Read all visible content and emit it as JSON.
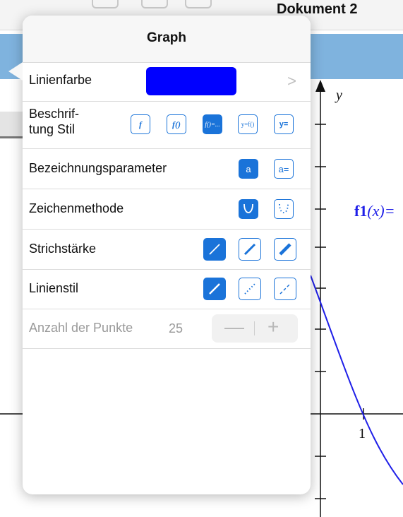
{
  "document": {
    "title": "Dokument 2"
  },
  "graph": {
    "axis_label_y": "y",
    "tick_label": "1",
    "function_label": "f1",
    "function_arg": "(x)="
  },
  "popover": {
    "title": "Graph",
    "rows": {
      "line_color": {
        "label": "Linienfarbe",
        "color": "#0000ff",
        "chevron": ">"
      },
      "label_style": {
        "label_line1": "Beschrif-",
        "label_line2": "tung Stil",
        "options": [
          "f",
          "f()",
          "f()=...",
          "y=f()",
          "y="
        ],
        "selected": "f()=..."
      },
      "param_label": {
        "label": "Bezeichnungsparameter",
        "options": [
          "a",
          "a="
        ],
        "selected": "a"
      },
      "draw_method": {
        "label": "Zeichenmethode",
        "options": [
          "continuous",
          "discrete"
        ],
        "selected": "continuous"
      },
      "line_weight": {
        "label": "Strichstärke",
        "options": [
          "thin",
          "medium",
          "thick"
        ],
        "selected": "thin"
      },
      "line_style": {
        "label": "Linienstil",
        "options": [
          "solid",
          "dotted",
          "dashed"
        ],
        "selected": "solid"
      },
      "num_points": {
        "label": "Anzahl der Punkte",
        "value": "25",
        "minus": "—",
        "plus": "+"
      }
    }
  }
}
